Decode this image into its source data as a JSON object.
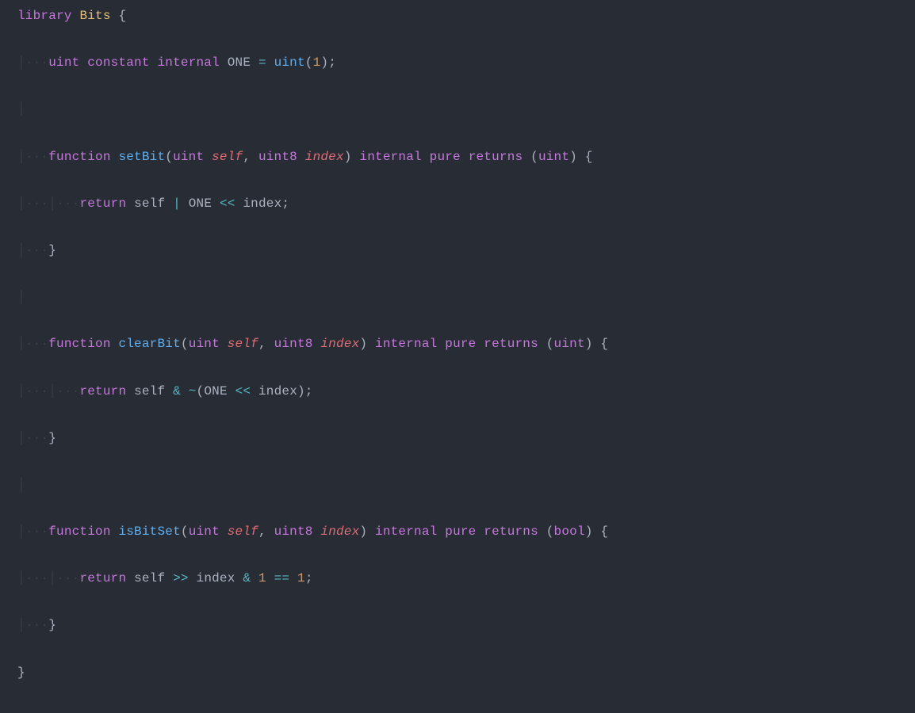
{
  "language": "solidity",
  "theme": {
    "name": "one-dark",
    "background": "#282c34"
  },
  "library_name": "Bits",
  "constant": {
    "type": "uint",
    "modifiers": [
      "constant",
      "internal"
    ],
    "name": "ONE",
    "value_expr": "uint(1)"
  },
  "functions": [
    {
      "name": "setBit",
      "params": [
        {
          "type": "uint",
          "name": "self"
        },
        {
          "type": "uint8",
          "name": "index"
        }
      ],
      "modifiers": [
        "internal",
        "pure"
      ],
      "returns": "uint",
      "body": "return self | ONE << index;"
    },
    {
      "name": "clearBit",
      "params": [
        {
          "type": "uint",
          "name": "self"
        },
        {
          "type": "uint8",
          "name": "index"
        }
      ],
      "modifiers": [
        "internal",
        "pure"
      ],
      "returns": "uint",
      "body": "return self & ~(ONE << index);"
    },
    {
      "name": "isBitSet",
      "params": [
        {
          "type": "uint",
          "name": "self"
        },
        {
          "type": "uint8",
          "name": "index"
        }
      ],
      "modifiers": [
        "internal",
        "pure"
      ],
      "returns": "bool",
      "body": "return self >> index & 1 == 1;"
    }
  ],
  "whitespace_glyph": "·",
  "indent_guide_glyph": "│",
  "rendered_lines": [
    "library Bits {",
    "    uint constant internal ONE = uint(1);",
    "",
    "    function setBit(uint self, uint8 index) internal pure returns (uint) {",
    "        return self | ONE << index;",
    "    }",
    "",
    "    function clearBit(uint self, uint8 index) internal pure returns (uint) {",
    "        return self & ~(ONE << index);",
    "    }",
    "",
    "    function isBitSet(uint self, uint8 index) internal pure returns (bool) {",
    "        return self >> index & 1 == 1;",
    "    }",
    "}"
  ]
}
